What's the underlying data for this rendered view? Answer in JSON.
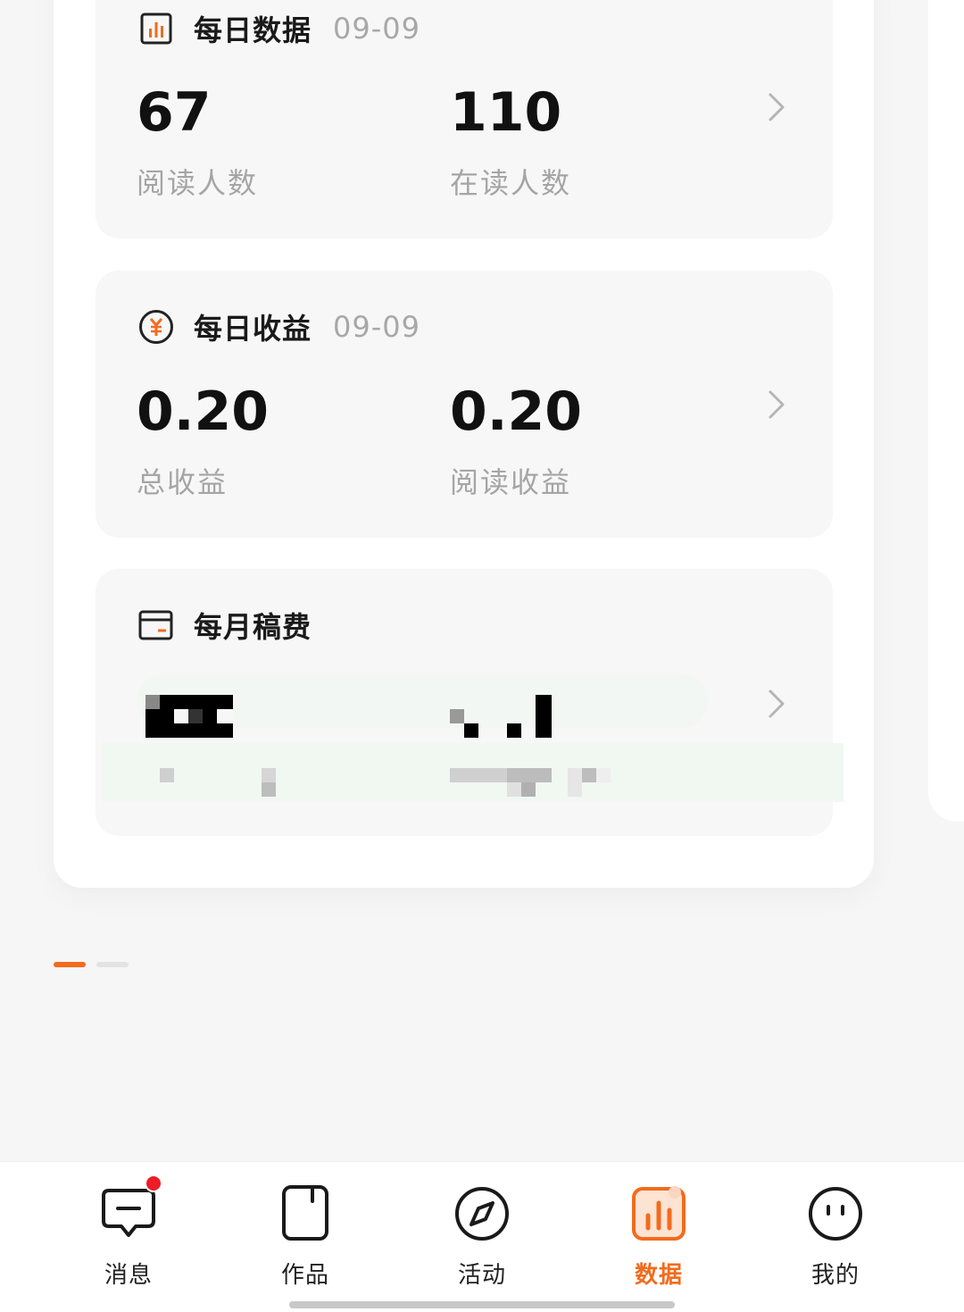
{
  "colors": {
    "accent": "#f26b1d",
    "badge": "#ee1c24",
    "muted_text": "#a5a5a5",
    "section_bg": "#f7f7f7",
    "page_bg": "#f6f6f6"
  },
  "daily_data": {
    "title": "每日数据",
    "date": "09-09",
    "icon": "bar-chart-icon",
    "stats": [
      {
        "value": "67",
        "label": "阅读人数"
      },
      {
        "value": "110",
        "label": "在读人数"
      }
    ]
  },
  "daily_income": {
    "title": "每日收益",
    "date": "09-09",
    "icon": "yuan-coin-icon",
    "stats": [
      {
        "value": "0.20",
        "label": "总收益"
      },
      {
        "value": "0.20",
        "label": "阅读收益"
      }
    ]
  },
  "monthly_fee": {
    "title": "每月稿费",
    "icon": "wallet-card-icon"
  },
  "pager": {
    "count": 2,
    "active_index": 0
  },
  "tabbar": {
    "tabs": [
      {
        "label": "消息",
        "icon": "message-icon",
        "badge": true
      },
      {
        "label": "作品",
        "icon": "book-icon",
        "badge": false
      },
      {
        "label": "活动",
        "icon": "compass-icon",
        "badge": false
      },
      {
        "label": "数据",
        "icon": "data-chart-icon",
        "badge": false,
        "active": true
      },
      {
        "label": "我的",
        "icon": "face-icon",
        "badge": false
      }
    ]
  }
}
